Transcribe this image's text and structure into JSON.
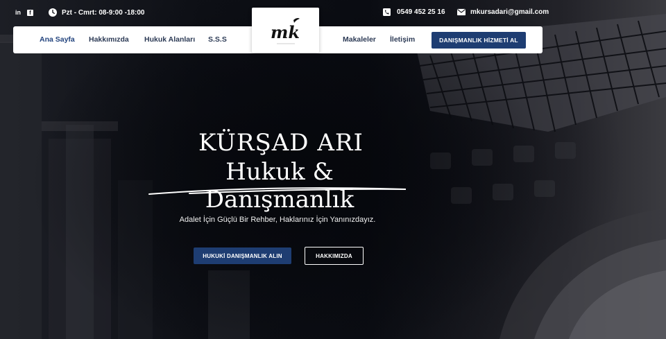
{
  "topbar": {
    "social": [
      {
        "name": "linkedin-icon",
        "glyph": "in"
      },
      {
        "name": "facebook-icon",
        "glyph": "f"
      }
    ],
    "hours": "Pzt - Cmrt: 08-9:00 -18:00",
    "phone": "0549 452 25 16",
    "email": "mkursadari@gmail.com"
  },
  "nav": {
    "left_items": [
      "Ana Sayfa",
      "Hakkımızda",
      "Hukuk Alanları",
      "S.S.S"
    ],
    "right_items": [
      "Makaleler",
      "İletişim"
    ],
    "cta_label": "DANIŞMANLIK HİZMETİ AL",
    "active_index": 0
  },
  "logo": {
    "text": "mk"
  },
  "hero": {
    "title": "KÜRŞAD ARI",
    "subtitle": "Hukuk & Danışmanlık",
    "tagline": "Adalet İçin Güçlü Bir Rehber, Haklarınız İçin Yanınızdayız.",
    "primary_button": "HUKUKİ DANIŞMANLIK ALIN",
    "secondary_button": "HAKKIMIZDA"
  },
  "colors": {
    "brand": "#1e3d72",
    "nav_text": "#2c3a55",
    "white": "#ffffff"
  }
}
